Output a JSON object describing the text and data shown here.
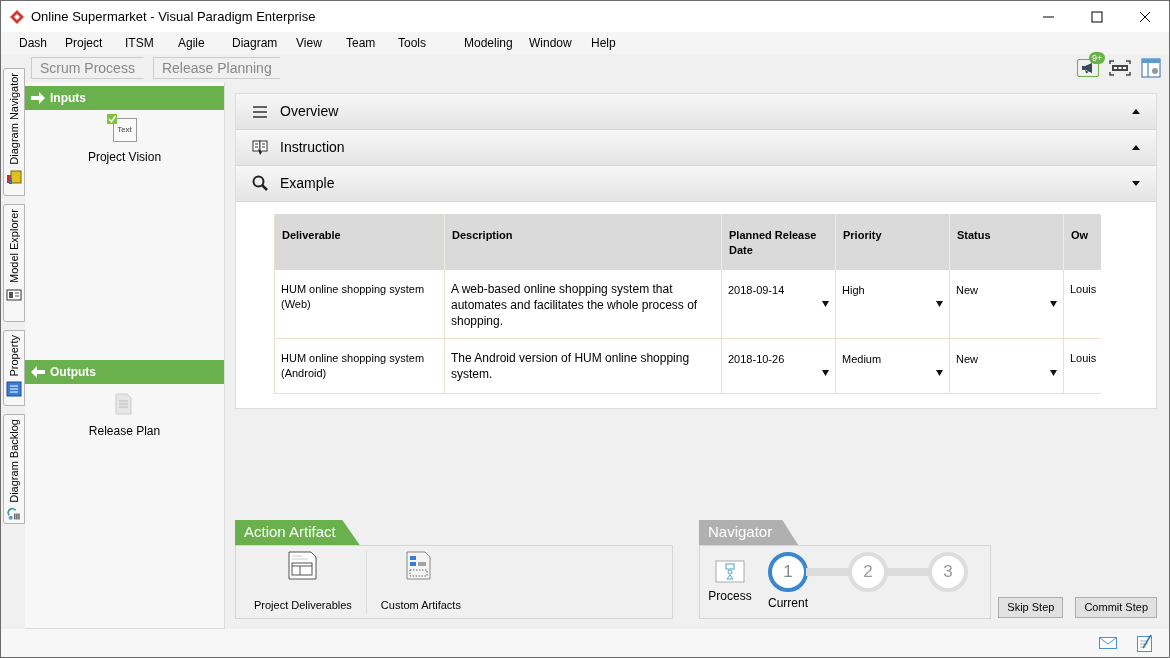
{
  "window": {
    "title": "Online Supermarket - Visual Paradigm Enterprise"
  },
  "menu": [
    "Dash",
    "Project",
    "ITSM",
    "Agile",
    "Diagram",
    "View",
    "Team",
    "Tools",
    "Modeling",
    "Window",
    "Help"
  ],
  "side_tabs": [
    {
      "label": "Diagram Navigator",
      "kind": "navigator"
    },
    {
      "label": "Model Explorer",
      "kind": "explorer"
    },
    {
      "label": "Property",
      "kind": "property"
    },
    {
      "label": "Diagram Backlog",
      "kind": "backlog"
    }
  ],
  "breadcrumb": [
    "Scrum Process",
    "Release Planning"
  ],
  "notification_badge": "9+",
  "inputs": {
    "title": "Inputs",
    "items": [
      {
        "label": "Project Vision",
        "kind": "text-doc",
        "icon_text": "Text",
        "checked": true
      }
    ]
  },
  "outputs": {
    "title": "Outputs",
    "items": [
      {
        "label": "Release Plan",
        "kind": "doc",
        "checked": false
      }
    ]
  },
  "sections": [
    {
      "title": "Overview",
      "kind": "overview",
      "expanded": false
    },
    {
      "title": "Instruction",
      "kind": "instruction",
      "expanded": false
    },
    {
      "title": "Example",
      "kind": "example",
      "expanded": true
    }
  ],
  "table": {
    "columns": [
      "Deliverable",
      "Description",
      "Planned Release Date",
      "Priority",
      "Status",
      "Ow"
    ],
    "rows": [
      {
        "cells": [
          "HUM online shopping system (Web)",
          "A web-based online shopping system that automates and facilitates the whole process of shopping.",
          "2018-09-14",
          "High",
          "New",
          "Louis"
        ]
      },
      {
        "cells": [
          "HUM online shopping system (Android)",
          "The Android version of HUM online shopping system.",
          "2018-10-26",
          "Medium",
          "New",
          "Louis"
        ]
      }
    ]
  },
  "action_artifact": {
    "title": "Action Artifact",
    "items": [
      {
        "label": "Project Deliverables",
        "kind": "table"
      },
      {
        "label": "Custom Artifacts",
        "kind": "custom"
      }
    ]
  },
  "navigator": {
    "title": "Navigator",
    "process_label": "Process",
    "steps": [
      {
        "label": "1",
        "caption": "Current",
        "selected": true
      },
      {
        "label": "2",
        "selected": false
      },
      {
        "label": "3",
        "selected": false
      }
    ]
  },
  "buttons": [
    "Skip Step",
    "Commit Step"
  ]
}
